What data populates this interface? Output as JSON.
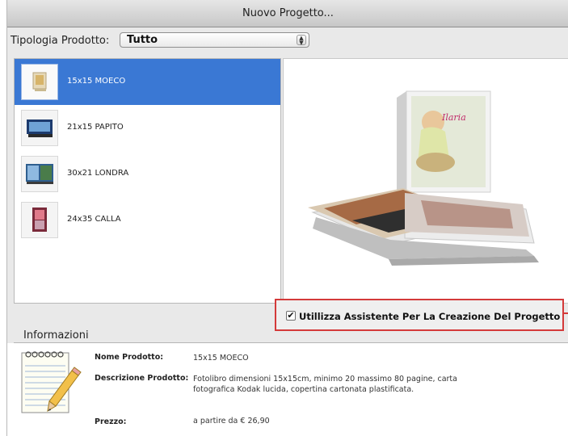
{
  "window": {
    "title": "Nuovo Progetto..."
  },
  "product_type": {
    "label": "Tipologia Prodotto:",
    "selected": "Tutto"
  },
  "products": [
    {
      "label": "15x15 MOECO",
      "selected": true
    },
    {
      "label": "21x15 PAPITO",
      "selected": false
    },
    {
      "label": "30x21 LONDRA",
      "selected": false
    },
    {
      "label": "24x35 CALLA",
      "selected": false
    }
  ],
  "preview": {
    "book_text": "Ilaria"
  },
  "assistant": {
    "checked": true,
    "check_glyph": "✔",
    "label": "Utillizza Assistente Per La Creazione Del Progetto"
  },
  "info": {
    "title": "Informazioni",
    "name_label": "Nome Prodotto:",
    "name_value": "15x15 MOECO",
    "desc_label": "Descrizione Prodotto:",
    "desc_value": "Fotolibro dimensioni 15x15cm, minimo 20 massimo 80 pagine, carta fotografica Kodak lucida, copertina cartonata plastificata.",
    "price_label": "Prezzo:",
    "price_value": "a partire da € 26,90"
  },
  "colors": {
    "selection": "#3a78d4",
    "highlight_border": "#d43a3a"
  }
}
